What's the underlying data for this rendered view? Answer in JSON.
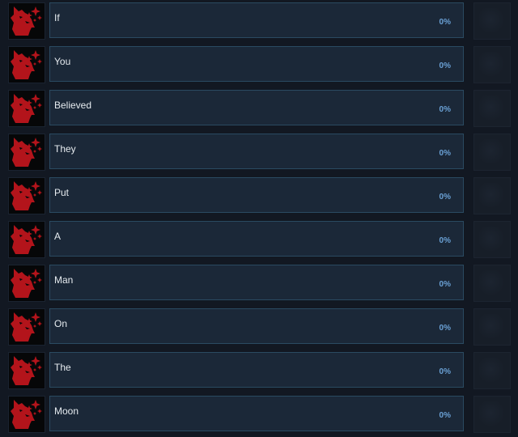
{
  "achievements": [
    {
      "name": "If",
      "percent": "0%",
      "icon": "red-wolf-icon"
    },
    {
      "name": "You",
      "percent": "0%",
      "icon": "red-wolf-icon"
    },
    {
      "name": "Believed",
      "percent": "0%",
      "icon": "red-wolf-icon"
    },
    {
      "name": "They",
      "percent": "0%",
      "icon": "red-wolf-icon"
    },
    {
      "name": "Put",
      "percent": "0%",
      "icon": "red-wolf-icon"
    },
    {
      "name": "A",
      "percent": "0%",
      "icon": "red-wolf-icon"
    },
    {
      "name": "Man",
      "percent": "0%",
      "icon": "red-wolf-icon"
    },
    {
      "name": "On",
      "percent": "0%",
      "icon": "red-wolf-icon"
    },
    {
      "name": "The",
      "percent": "0%",
      "icon": "red-wolf-icon"
    },
    {
      "name": "Moon",
      "percent": "0%",
      "icon": "red-wolf-icon"
    }
  ],
  "colors": {
    "background": "#121822",
    "panel": "#1b2838",
    "panel_border": "#2a4a61",
    "label": "#e6ebef",
    "percent": "#6aa0d4",
    "icon_red": "#b3141b"
  }
}
